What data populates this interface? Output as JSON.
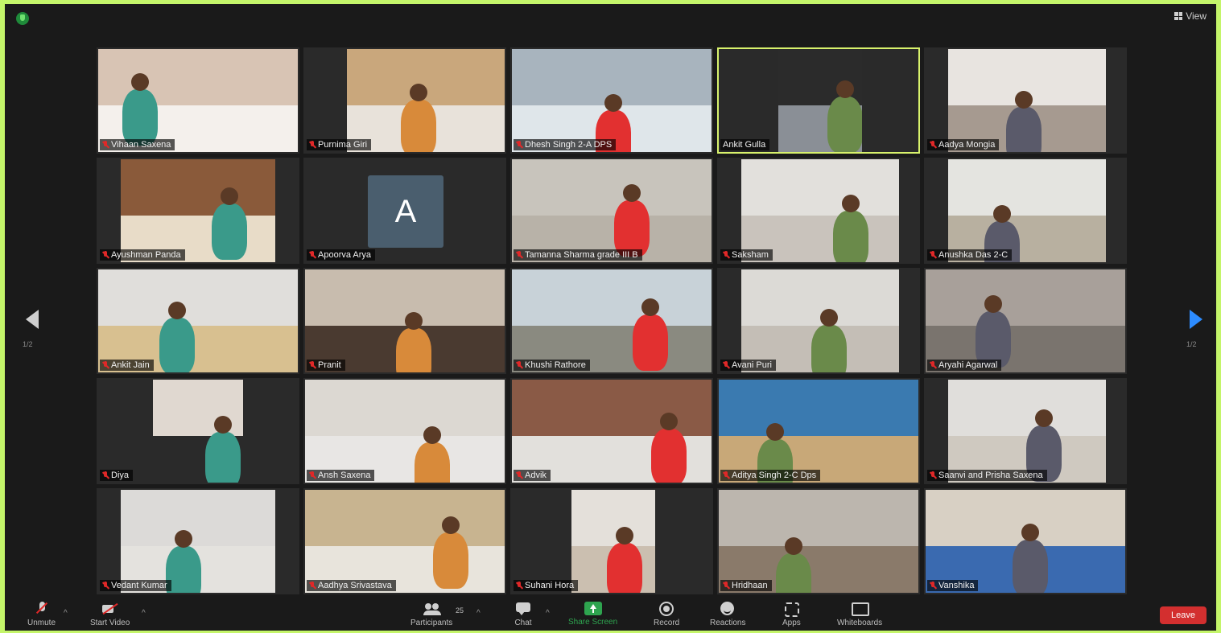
{
  "header": {
    "view_label": "View"
  },
  "navigation": {
    "prev_page": "1/2",
    "next_page": "1/2"
  },
  "participants": [
    {
      "name": "Vihaan Saxena",
      "muted": true,
      "bg": "#d8c4b4",
      "fg": "#f4f0ec"
    },
    {
      "name": "Purnima Giri",
      "muted": true,
      "bg": "#c9a77c",
      "fg": "#e8e2da"
    },
    {
      "name": "Dhesh Singh 2-A DPS",
      "muted": true,
      "bg": "#a8b4be",
      "fg": "#dfe6ea"
    },
    {
      "name": "Ankit Gulla",
      "muted": false,
      "active": true,
      "bg": "#2b2b2b",
      "fg": "#8a8f96"
    },
    {
      "name": "Aadya Mongia",
      "muted": true,
      "bg": "#e8e4e0",
      "fg": "#a69a90"
    },
    {
      "name": "Ayushman Panda",
      "muted": true,
      "bg": "#8a5a3a",
      "fg": "#e8dcc8"
    },
    {
      "name": "Apoorva Arya",
      "muted": true,
      "avatar": "A",
      "bg": "#2a2a2a",
      "fg": "#2a2a2a"
    },
    {
      "name": "Tamanna Sharma grade III B",
      "muted": true,
      "bg": "#c8c4bc",
      "fg": "#b8b2a8"
    },
    {
      "name": "Saksham",
      "muted": true,
      "bg": "#e2e0dc",
      "fg": "#c9c3bc"
    },
    {
      "name": "Anushka Das 2-C",
      "muted": true,
      "bg": "#e4e4e0",
      "fg": "#b8b0a0"
    },
    {
      "name": "Ankit Jain",
      "muted": true,
      "bg": "#e0dedb",
      "fg": "#d8c090"
    },
    {
      "name": "Pranit",
      "muted": true,
      "bg": "#c8bcae",
      "fg": "#4a3a30"
    },
    {
      "name": "Khushi Rathore",
      "muted": true,
      "bg": "#c8d2d8",
      "fg": "#8a8a80"
    },
    {
      "name": "Avani Puri",
      "muted": true,
      "bg": "#dcdad6",
      "fg": "#c4beb6"
    },
    {
      "name": "Aryahi Agarwal",
      "muted": true,
      "bg": "#a8a09a",
      "fg": "#7a746e"
    },
    {
      "name": "Diya",
      "muted": true,
      "bg": "#e0d8d0",
      "fg": "#2a2a2a"
    },
    {
      "name": "Ansh Saxena",
      "muted": true,
      "bg": "#dcd8d2",
      "fg": "#e8e6e4"
    },
    {
      "name": "Advik",
      "muted": true,
      "bg": "#8a5a46",
      "fg": "#e2e0dc"
    },
    {
      "name": "Aditya Singh 2-C Dps",
      "muted": true,
      "bg": "#3a7ab0",
      "fg": "#c8a878"
    },
    {
      "name": "Saanvi and Prisha Saxena",
      "muted": true,
      "bg": "#e0dedb",
      "fg": "#cfc9c0"
    },
    {
      "name": "Vedant Kumar",
      "muted": true,
      "bg": "#dcdad8",
      "fg": "#e4e2de"
    },
    {
      "name": "Aadhya Srivastava",
      "muted": true,
      "bg": "#c8b490",
      "fg": "#e8e4dc"
    },
    {
      "name": "Suhani Hora",
      "muted": true,
      "bg": "#e4e0da",
      "fg": "#cbbfb0"
    },
    {
      "name": "Hridhaan",
      "muted": true,
      "bg": "#bcb6ae",
      "fg": "#8a7a6a"
    },
    {
      "name": "Vanshika",
      "muted": true,
      "bg": "#d8d0c4",
      "fg": "#3a6ab0"
    }
  ],
  "toolbar": {
    "unmute": "Unmute",
    "start_video": "Start Video",
    "participants": "Participants",
    "participants_count": "25",
    "chat": "Chat",
    "share_screen": "Share Screen",
    "record": "Record",
    "reactions": "Reactions",
    "apps": "Apps",
    "whiteboards": "Whiteboards",
    "leave": "Leave"
  },
  "colors": {
    "frame": "#c4f56a",
    "background": "#1a1a1a",
    "active_speaker": "#d8f26c",
    "share": "#2ea44f",
    "leave": "#d32f2f",
    "next_arrow": "#2d8cff"
  },
  "icons": [
    "shield-icon",
    "view-grid-icon",
    "prev-arrow-icon",
    "next-arrow-icon",
    "mic-muted-icon",
    "video-off-icon",
    "participants-icon",
    "chat-icon",
    "share-screen-icon",
    "record-icon",
    "reactions-icon",
    "apps-icon",
    "whiteboards-icon"
  ]
}
